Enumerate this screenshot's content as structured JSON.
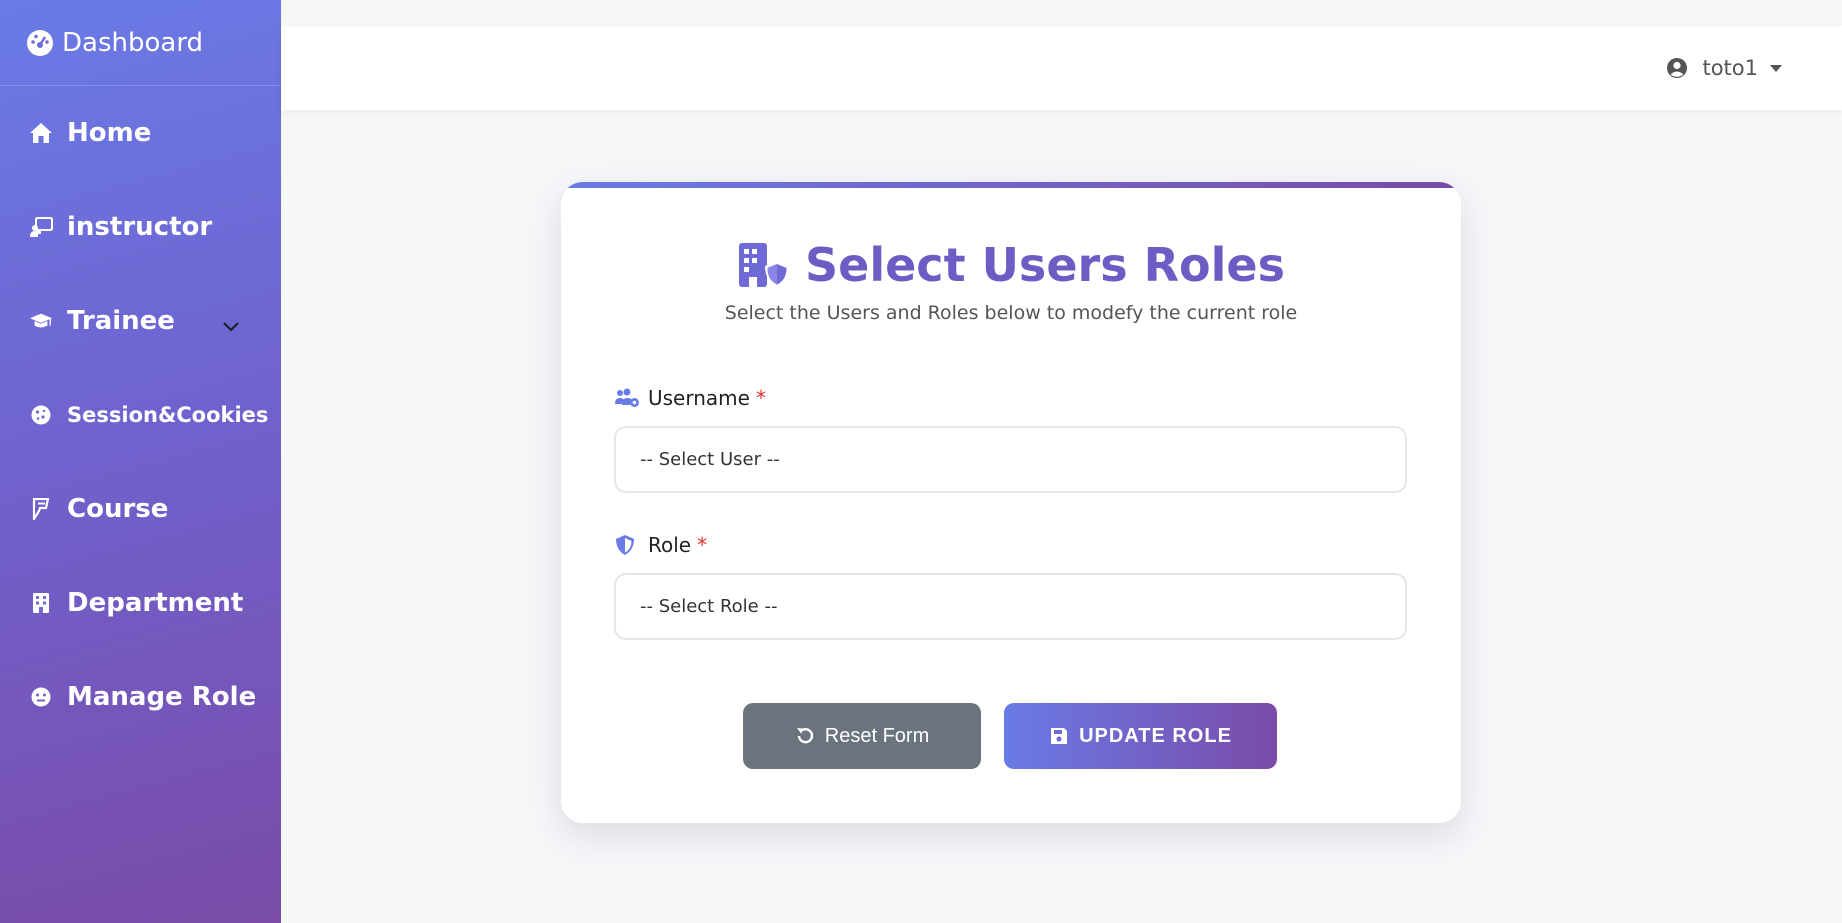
{
  "sidebar": {
    "brand": "Dashboard",
    "items": [
      {
        "label": "Home",
        "icon": "home-icon"
      },
      {
        "label": "instructor",
        "icon": "chalkboard-teacher-icon"
      },
      {
        "label": "Trainee",
        "icon": "graduation-cap-icon"
      },
      {
        "label": "Session&Cookies",
        "icon": "cookie-icon"
      },
      {
        "label": "Course",
        "icon": "foursquare-icon"
      },
      {
        "label": "Department",
        "icon": "building-icon"
      },
      {
        "label": "Manage Role",
        "icon": "face-icon"
      }
    ]
  },
  "topbar": {
    "user_name": "toto1"
  },
  "form": {
    "title": "Select Users Roles",
    "subtitle": "Select the Users and Roles below to modefy the current role",
    "username_label": "Username",
    "username_placeholder": "-- Select User --",
    "role_label": "Role",
    "role_placeholder": "-- Select Role --",
    "required_mark": "*",
    "reset_label": "Reset Form",
    "update_label": "UPDATE ROLE"
  },
  "colors": {
    "accent_start": "#6a7be6",
    "accent_end": "#7a4ba8",
    "title": "#6f5bc4",
    "reset_button": "#6b747d",
    "required": "#e03131"
  }
}
